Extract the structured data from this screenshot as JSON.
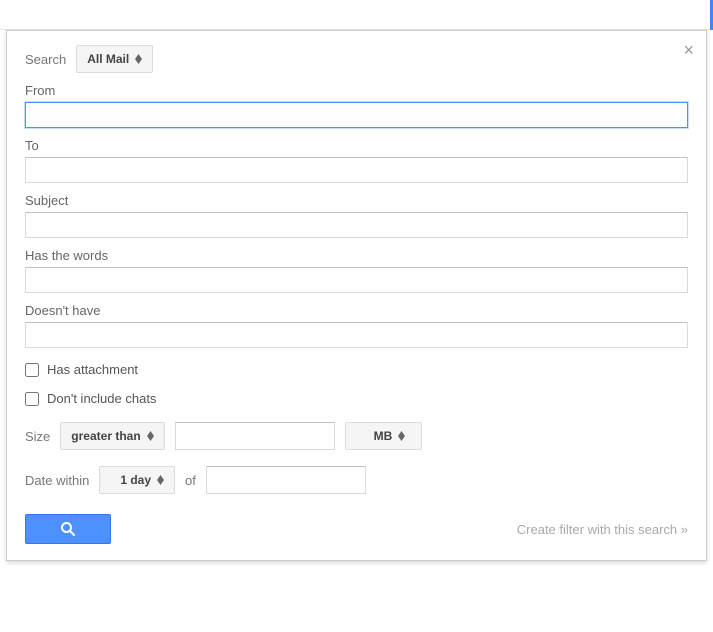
{
  "header": {
    "search_label": "Search",
    "scope_selected": "All Mail"
  },
  "fields": {
    "from": {
      "label": "From",
      "value": ""
    },
    "to": {
      "label": "To",
      "value": ""
    },
    "subject": {
      "label": "Subject",
      "value": ""
    },
    "has_words": {
      "label": "Has the words",
      "value": ""
    },
    "doesnt_have": {
      "label": "Doesn't have",
      "value": ""
    }
  },
  "checkboxes": {
    "has_attachment": {
      "label": "Has attachment",
      "checked": false
    },
    "dont_include_chats": {
      "label": "Don't include chats",
      "checked": false
    }
  },
  "size": {
    "label": "Size",
    "comparator_selected": "greater than",
    "value": "",
    "unit_selected": "MB"
  },
  "date": {
    "label": "Date within",
    "range_selected": "1 day",
    "of_label": "of",
    "value": ""
  },
  "footer": {
    "create_filter_label": "Create filter with this search »"
  }
}
